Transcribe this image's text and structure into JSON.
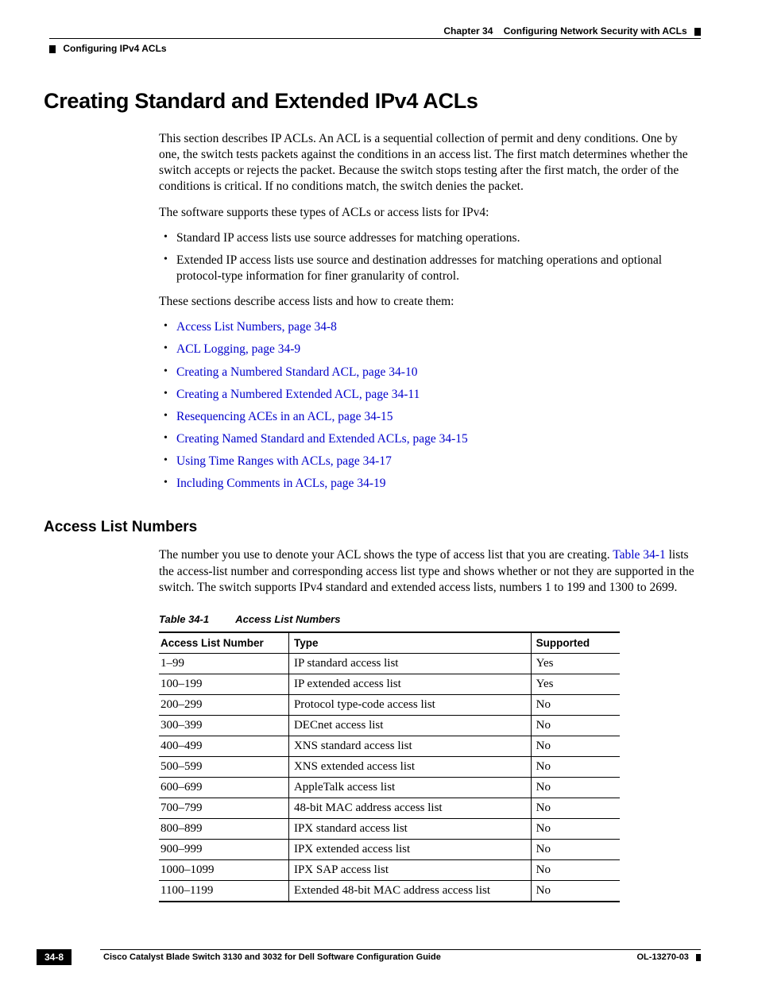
{
  "header": {
    "chapter_label": "Chapter 34",
    "chapter_title": "Configuring Network Security with ACLs",
    "section": "Configuring IPv4 ACLs"
  },
  "h1": "Creating Standard and Extended IPv4 ACLs",
  "intro_p1": "This section describes IP ACLs. An ACL is a sequential collection of permit and deny conditions. One by one, the switch tests packets against the conditions in an access list. The first match determines whether the switch accepts or rejects the packet. Because the switch stops testing after the first match, the order of the conditions is critical. If no conditions match, the switch denies the packet.",
  "intro_p2": "The software supports these types of ACLs or access lists for IPv4:",
  "type_bullets": [
    "Standard IP access lists use source addresses for matching operations.",
    "Extended IP access lists use source and destination addresses for matching operations and optional protocol-type information for finer granularity of control."
  ],
  "intro_p3": "These sections describe access lists and how to create them:",
  "link_bullets": [
    "Access List Numbers, page 34-8",
    "ACL Logging, page 34-9",
    "Creating a Numbered Standard ACL, page 34-10",
    "Creating a Numbered Extended ACL, page 34-11",
    "Resequencing ACEs in an ACL, page 34-15",
    "Creating Named Standard and Extended ACLs, page 34-15",
    "Using Time Ranges with ACLs, page 34-17",
    "Including Comments in ACLs, page 34-19"
  ],
  "h2": "Access List Numbers",
  "aln_p_pre": "The number you use to denote your ACL shows the type of access list that you are creating. ",
  "aln_link": "Table 34-1",
  "aln_p_post": " lists the access-list number and corresponding access list type and shows whether or not they are supported in the switch. The switch supports IPv4 standard and extended access lists, numbers 1 to 199 and 1300 to 2699.",
  "table": {
    "caption_num": "Table 34-1",
    "caption_title": "Access List Numbers",
    "headers": {
      "c1": "Access List Number",
      "c2": "Type",
      "c3": "Supported"
    },
    "rows": [
      {
        "num": "1–99",
        "type": "IP standard access list",
        "sup": "Yes"
      },
      {
        "num": "100–199",
        "type": "IP extended access list",
        "sup": "Yes"
      },
      {
        "num": "200–299",
        "type": "Protocol type-code access list",
        "sup": "No"
      },
      {
        "num": "300–399",
        "type": "DECnet access list",
        "sup": "No"
      },
      {
        "num": "400–499",
        "type": "XNS standard access list",
        "sup": "No"
      },
      {
        "num": "500–599",
        "type": "XNS extended access list",
        "sup": "No"
      },
      {
        "num": "600–699",
        "type": "AppleTalk access list",
        "sup": "No"
      },
      {
        "num": "700–799",
        "type": "48-bit MAC address access list",
        "sup": "No"
      },
      {
        "num": "800–899",
        "type": "IPX standard access list",
        "sup": "No"
      },
      {
        "num": "900–999",
        "type": "IPX extended access list",
        "sup": "No"
      },
      {
        "num": "1000–1099",
        "type": "IPX SAP access list",
        "sup": "No"
      },
      {
        "num": "1100–1199",
        "type": "Extended 48-bit MAC address access list",
        "sup": "No"
      }
    ]
  },
  "footer": {
    "book": "Cisco Catalyst Blade Switch 3130 and 3032 for Dell Software Configuration Guide",
    "page": "34-8",
    "docid": "OL-13270-03"
  }
}
